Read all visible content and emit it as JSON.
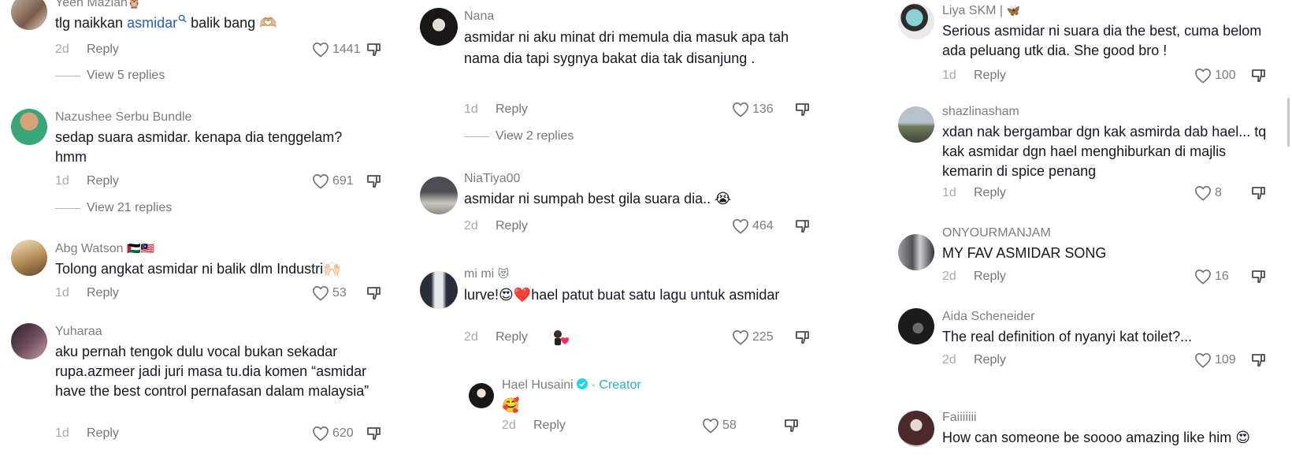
{
  "columns": [
    {
      "comments": [
        {
          "name": "Yeen Mazlan",
          "name_suffix": "🦉",
          "text_parts": [
            "tlg naikkan ",
            "asmidar",
            " balik bang 🫶🏼"
          ],
          "date": "2d",
          "reply": "Reply",
          "likes": "1441",
          "view_replies": "View 5 replies"
        },
        {
          "name": "Nazushee Serbu Bundle",
          "text": "sedap suara asmidar. kenapa dia tenggelam? hmm",
          "date": "1d",
          "reply": "Reply",
          "likes": "691",
          "view_replies": "View 21 replies"
        },
        {
          "name": "Abg Watson",
          "name_suffix": "🇵🇸🇲🇾",
          "text": "Tolong angkat asmidar ni balik dlm Industri🙌🏻",
          "date": "1d",
          "reply": "Reply",
          "likes": "53"
        },
        {
          "name": "Yuharaa",
          "text": "aku pernah tengok dulu vocal bukan sekadar rupa.azmeer jadi juri masa tu.dia komen “asmidar have the best control pernafasan dalam malaysia”",
          "date": "1d",
          "reply": "Reply",
          "likes": "620"
        }
      ]
    },
    {
      "comments": [
        {
          "name": "Nana",
          "text": "asmidar ni aku minat dri memula dia masuk apa tah nama dia tapi sygnya bakat dia tak disanjung .",
          "date": "1d",
          "reply": "Reply",
          "likes": "136",
          "view_replies": "View 2 replies"
        },
        {
          "name": "NiaTiya00",
          "text": "asmidar ni sumpah best gila suara dia.. 😭",
          "date": "2d",
          "reply": "Reply",
          "likes": "464"
        },
        {
          "name": "mi mi",
          "name_suffix": "😻",
          "text": "lurve!😍❤️hael patut buat satu lagu untuk asmidar",
          "date": "2d",
          "reply": "Reply",
          "likes": "225"
        },
        {
          "name": "Hael Husaini",
          "creator_label": "· Creator",
          "text": "🥰",
          "date": "2d",
          "reply": "Reply",
          "likes": "58"
        }
      ]
    },
    {
      "comments": [
        {
          "name": "Liya SKM |",
          "name_suffix": "🦋",
          "text": "Serious asmidar ni suara dia the best, cuma belom ada peluang utk dia. She good bro !",
          "date": "1d",
          "reply": "Reply",
          "likes": "100"
        },
        {
          "name": "shazlinasham",
          "text": "xdan nak bergambar dgn kak asmirda dab hael... tq kak asmidar dgn hael menghiburkan di majlis kemarin di spice penang",
          "date": "1d",
          "reply": "Reply",
          "likes": "8"
        },
        {
          "name": "ONYOURMANJAM",
          "text": "MY FAV ASMIDAR SONG",
          "date": "2d",
          "reply": "Reply",
          "likes": "16"
        },
        {
          "name": "Aida Scheneider",
          "text": "The real definition of nyanyi kat toilet?...",
          "date": "2d",
          "reply": "Reply",
          "likes": "109"
        },
        {
          "name": "Faiiiiiii",
          "text": "How can someone be soooo amazing like him 😍",
          "date": "",
          "reply": "",
          "likes": ""
        }
      ]
    }
  ],
  "colors": {
    "link": "#2b5db8",
    "creator": "#2eaac6",
    "verified": "#20d5ec",
    "meta": "#8a8b91"
  },
  "icons": [
    "heart-icon",
    "dislike-icon",
    "search-icon",
    "verified-icon",
    "sticker-heart-icon"
  ]
}
